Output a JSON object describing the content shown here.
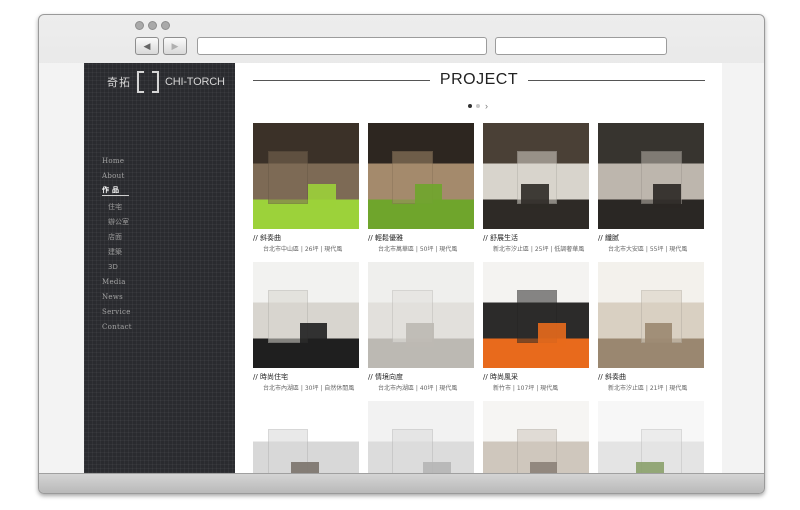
{
  "site": {
    "logo": {
      "zh": "奇拓",
      "en": "CHI-TORCH"
    },
    "menu": [
      {
        "label": "Home"
      },
      {
        "label": "About"
      },
      {
        "label": "作 品",
        "active": true
      },
      {
        "label": "住宅",
        "sub": true
      },
      {
        "label": "辦公室",
        "sub": true
      },
      {
        "label": "店面",
        "sub": true
      },
      {
        "label": "建築",
        "sub": true
      },
      {
        "label": "3D",
        "sub": true
      },
      {
        "label": "Media"
      },
      {
        "label": "News"
      },
      {
        "label": "Service"
      },
      {
        "label": "Contact"
      }
    ],
    "heading": "PROJECT",
    "pager": {
      "pages": 2,
      "current": 1,
      "next_icon": "chevron-right-icon",
      "next_glyph": "›"
    },
    "projects": [
      {
        "title": "// 斜奏曲",
        "meta": "台北市中山區 | 26坪 | 現代風",
        "palette": [
          "#3b3128",
          "#7d6a55",
          "#9cd23a"
        ]
      },
      {
        "title": "// 輕鬆優雅",
        "meta": "台北市萬華區 | 50坪 | 現代風",
        "palette": [
          "#2d2620",
          "#a48a6c",
          "#6fa52c"
        ]
      },
      {
        "title": "// 舒展生活",
        "meta": "新北市汐止區 | 25坪 | 低調奢華風",
        "palette": [
          "#4a4036",
          "#d8d4cc",
          "#2e2a26"
        ]
      },
      {
        "title": "// 纖腻",
        "meta": "台北市大安區 | 55坪 | 現代風",
        "palette": [
          "#37342f",
          "#bdb6ad",
          "#2a2724"
        ]
      },
      {
        "title": "// 時尚住宅",
        "meta": "台北市內湖區 | 30坪 | 自然休閒風",
        "palette": [
          "#f2f2f0",
          "#d8d5cf",
          "#1f1f1f"
        ]
      },
      {
        "title": "// 情境向度",
        "meta": "台北市內湖區 | 40坪 | 現代風",
        "palette": [
          "#efefed",
          "#e2e0dc",
          "#bcb9b3"
        ]
      },
      {
        "title": "// 時尚風采",
        "meta": "新竹市 | 107坪 | 現代風",
        "palette": [
          "#f4f3f1",
          "#2c2b2a",
          "#e86a1c"
        ]
      },
      {
        "title": "// 斜奏曲",
        "meta": "新北市汐止區 | 21坪 | 現代風",
        "palette": [
          "#f3f1ec",
          "#d9d0c2",
          "#9a8770"
        ]
      },
      {
        "title": "",
        "meta": "",
        "palette": [
          "#ffffff",
          "#d8d8d8",
          "#7b736c"
        ]
      },
      {
        "title": "",
        "meta": "",
        "palette": [
          "#f2f2f2",
          "#dcdcdc",
          "#b5b5b5"
        ]
      },
      {
        "title": "",
        "meta": "",
        "palette": [
          "#f6f5f3",
          "#cfc7bd",
          "#8b8178"
        ]
      },
      {
        "title": "",
        "meta": "",
        "palette": [
          "#f7f7f7",
          "#e4e4e4",
          "#8aa06a"
        ]
      }
    ]
  }
}
